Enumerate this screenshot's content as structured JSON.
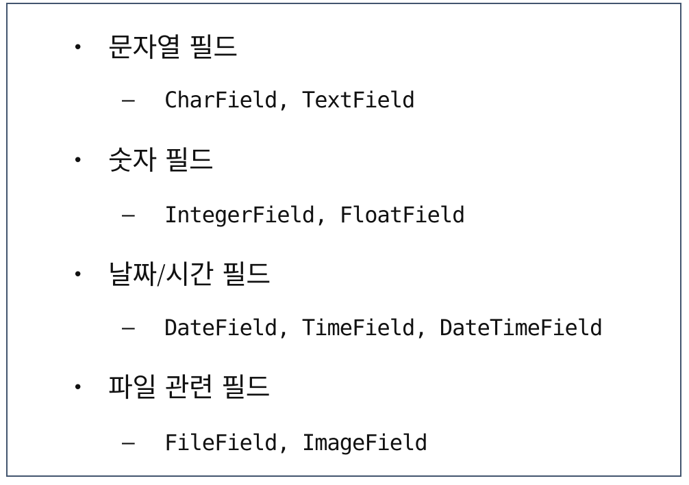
{
  "sections": [
    {
      "bullet": "•",
      "title": "문자열 필드",
      "dash": "–",
      "items": "CharField, TextField"
    },
    {
      "bullet": "•",
      "title": "숫자 필드",
      "dash": "–",
      "items": "IntegerField, FloatField"
    },
    {
      "bullet": "•",
      "title": "날짜/시간 필드",
      "dash": "–",
      "items": "DateField, TimeField, DateTimeField"
    },
    {
      "bullet": "•",
      "title": "파일 관련 필드",
      "dash": "–",
      "items": "FileField, ImageField"
    }
  ]
}
